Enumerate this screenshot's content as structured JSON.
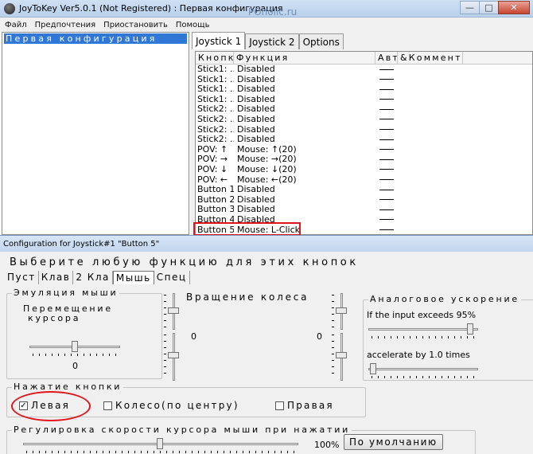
{
  "window": {
    "title": "JoyToKey Ver5.0.1 (Not Registered) : Первая конфигурация",
    "watermark": "POholic.ru",
    "minimize": "—",
    "maximize": "□",
    "close": "✕"
  },
  "menu": [
    "Файл",
    "Предпочтения",
    "Приостановить",
    "Помощь"
  ],
  "configs": [
    "Первая конфигурация"
  ],
  "tabs": [
    "Joystick 1",
    "Joystick 2",
    "Options"
  ],
  "columns": [
    "Кнопка",
    "Функция",
    "Авто",
    "&Комментарий"
  ],
  "rows": [
    {
      "button": "Stick1: ...",
      "function": "Disabled"
    },
    {
      "button": "Stick1: ...",
      "function": "Disabled"
    },
    {
      "button": "Stick1: ...",
      "function": "Disabled"
    },
    {
      "button": "Stick1: ...",
      "function": "Disabled"
    },
    {
      "button": "Stick2: ...",
      "function": "Disabled"
    },
    {
      "button": "Stick2: ...",
      "function": "Disabled"
    },
    {
      "button": "Stick2: ...",
      "function": "Disabled"
    },
    {
      "button": "Stick2: ...",
      "function": "Disabled"
    },
    {
      "button": "POV: ↑",
      "function": "Mouse: ↑(20)"
    },
    {
      "button": "POV: →",
      "function": "Mouse: →(20)"
    },
    {
      "button": "POV: ↓",
      "function": "Mouse: ↓(20)"
    },
    {
      "button": "POV: ←",
      "function": "Mouse: ←(20)"
    },
    {
      "button": "Button 1",
      "function": "Disabled"
    },
    {
      "button": "Button 2",
      "function": "Disabled"
    },
    {
      "button": "Button 3",
      "function": "Disabled"
    },
    {
      "button": "Button 4",
      "function": "Disabled"
    },
    {
      "button": "Button 5",
      "function": "Mouse: L-Click"
    }
  ],
  "dialog": {
    "title": "Configuration for Joystick#1 \"Button 5\"",
    "heading": "Выберите любую функцию для этих кнопок",
    "subtabs": [
      "Пуст",
      "Клав",
      "2 Кла",
      "Мышь",
      "Спец"
    ],
    "emulation": {
      "label": "Эмуляция мыши",
      "cursor_move_1": "Перемещение",
      "cursor_move_2": "курсора",
      "cursor_value": "0",
      "wheel_label": "Вращение колеса",
      "wheel_left_value": "0",
      "wheel_right_value": "0",
      "analog_label": "Аналоговое ускорение",
      "exceeds_label": "If the input exceeds 95%",
      "exceeds_level": 0.95,
      "accelerate_label": "accelerate by 1.0 times"
    },
    "click": {
      "label": "Нажатие кнопки",
      "left": "Левая",
      "left_checked": true,
      "middle": "Колесо(по центру)",
      "middle_checked": false,
      "right": "Правая",
      "right_checked": false,
      "check_mark": "✓"
    },
    "speed": {
      "label": "Регулировка скорости курсора мыши при нажатии",
      "value": "100%",
      "default_button": "По умолчанию"
    }
  }
}
